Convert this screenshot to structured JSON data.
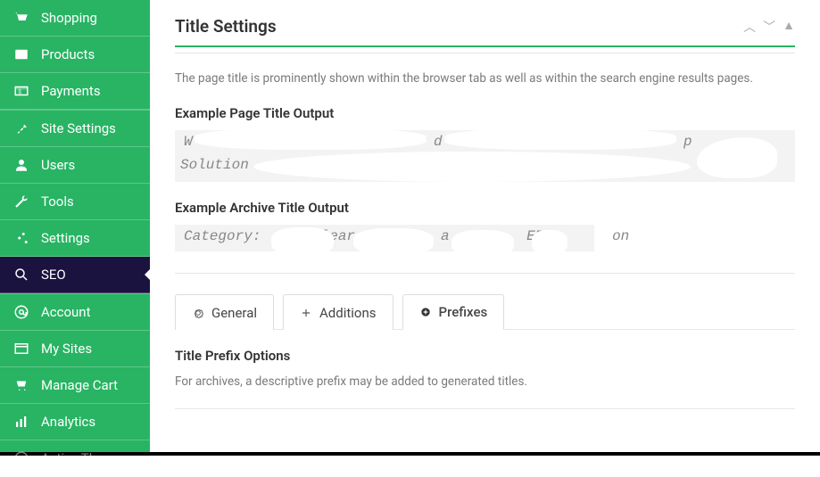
{
  "sidebar": {
    "items": [
      {
        "label": "Shopping"
      },
      {
        "label": "Products"
      },
      {
        "label": "Payments"
      },
      {
        "label": "Site Settings"
      },
      {
        "label": "Users"
      },
      {
        "label": "Tools"
      },
      {
        "label": "Settings"
      },
      {
        "label": "SEO"
      },
      {
        "label": "Account"
      },
      {
        "label": "My Sites"
      },
      {
        "label": "Manage Cart"
      },
      {
        "label": "Analytics"
      },
      {
        "label": "Active Theme"
      }
    ]
  },
  "panel": {
    "title": "Title Settings",
    "description": "The page title is prominently shown within the browser tab as well as within the search engine results pages.",
    "example_page_label": "Example Page Title Output",
    "example_page_value_front": "W",
    "example_page_value_mid": "d",
    "example_page_value_end": "p",
    "example_page_value_line2": "Solution",
    "example_archive_label": "Example Archive Title Output",
    "example_archive_value": "Category:   E   lear          a  Sma    ERP       on",
    "tabs": {
      "general": "General",
      "additions": "Additions",
      "prefixes": "Prefixes"
    },
    "prefix_options_label": "Title Prefix Options",
    "prefix_options_desc": "For archives, a descriptive prefix may be added to generated titles."
  }
}
